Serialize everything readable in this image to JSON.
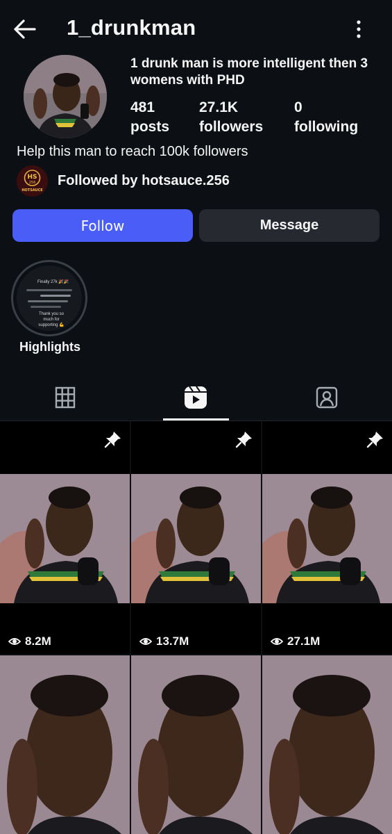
{
  "header": {
    "username": "1_drunkman",
    "back_icon": "arrow-left-icon",
    "menu_icon": "more-vertical-icon"
  },
  "profile": {
    "title": "1 drunk man is more intelligent then 3 womens with PHD",
    "stats": [
      {
        "value": "481",
        "label": "posts"
      },
      {
        "value": "27.1K",
        "label": "followers"
      },
      {
        "value": "0",
        "label": "following"
      }
    ],
    "bio": "Help this man to reach 100k followers",
    "followed_by": "Followed by hotsauce.256",
    "followed_by_avatar_text": {
      "top": "HS",
      "mid": "256",
      "bottom": "HOTSAUCE"
    }
  },
  "buttons": {
    "follow": "Follow",
    "message": "Message"
  },
  "highlight": {
    "label": "Highlights",
    "preview_top": "Finally 27k 🎉🎉",
    "preview_bottom": "Thank you so much for supporting 💪"
  },
  "tabs": [
    {
      "name": "grid",
      "icon": "grid-icon"
    },
    {
      "name": "reels",
      "icon": "reels-icon",
      "active": true
    },
    {
      "name": "tagged",
      "icon": "tagged-user-icon"
    }
  ],
  "reels": [
    {
      "views": "8.2M",
      "pinned": true
    },
    {
      "views": "13.7M",
      "pinned": true
    },
    {
      "views": "27.1M",
      "pinned": true
    },
    {
      "views": "",
      "pinned": false
    },
    {
      "views": "",
      "pinned": false
    },
    {
      "views": "",
      "pinned": false
    }
  ],
  "colors": {
    "background": "#0c1014",
    "follow_button": "#4b5df7",
    "message_button": "#262a30"
  }
}
